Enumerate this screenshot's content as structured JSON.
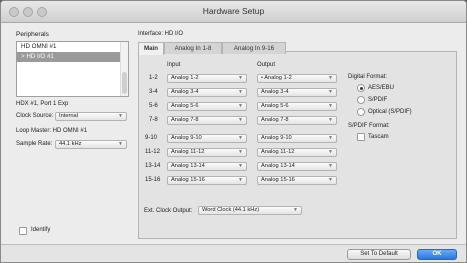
{
  "window": {
    "title": "Hardware Setup"
  },
  "sidebar": {
    "peripherals_label": "Peripherals",
    "peripherals": [
      "HD OMNI #1",
      "> HD I/O #1"
    ],
    "selected_index": 1,
    "port_info": "HDX #1, Port 1 Exp",
    "clock_source_label": "Clock Source:",
    "clock_source_value": "Internal",
    "loop_master": "Loop Master: HD OMNI #1",
    "sample_rate_label": "Sample Rate:",
    "sample_rate_value": "44.1 kHz",
    "identify_label": "Identify"
  },
  "interface": {
    "label": "Interface: HD I/O",
    "tabs": [
      "Main",
      "Analog In 1-8",
      "Analog In 9-16"
    ],
    "active_tab": 0,
    "input_header": "Input",
    "output_header": "Output",
    "rows": [
      {
        "channel": "1-2",
        "input": "Analog 1-2",
        "output": "• Analog 1-2"
      },
      {
        "channel": "3-4",
        "input": "Analog 3-4",
        "output": "Analog 3-4"
      },
      {
        "channel": "5-6",
        "input": "Analog 5-6",
        "output": "Analog 5-6"
      },
      {
        "channel": "7-8",
        "input": "Analog 7-8",
        "output": "Analog 7-8"
      },
      {
        "channel": "9-10",
        "input": "Analog 9-10",
        "output": "Analog 9-10"
      },
      {
        "channel": "11-12",
        "input": "Analog 11-12",
        "output": "Analog 11-12"
      },
      {
        "channel": "13-14",
        "input": "Analog 13-14",
        "output": "Analog 13-14"
      },
      {
        "channel": "15-16",
        "input": "Analog 15-16",
        "output": "Analog 15-16"
      }
    ],
    "digital_format_label": "Digital Format:",
    "digital_formats": [
      "AES/EBU",
      "S/PDIF",
      "Optical (S/PDIF)"
    ],
    "digital_format_selected": 0,
    "spdif_format_label": "S/PDIF Format:",
    "spdif_option": "Tascam",
    "ext_clock_label": "Ext. Clock Output:",
    "ext_clock_value": "Word Clock (44.1 kHz)"
  },
  "footer": {
    "set_default_label": "Set To Default",
    "ok_label": "OK"
  }
}
